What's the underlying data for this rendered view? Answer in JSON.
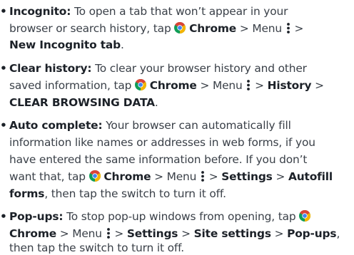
{
  "bullet_symbol": "•",
  "icons": {
    "chrome": "chrome-icon",
    "menu": "menu-dots-icon"
  },
  "colors": {
    "chrome_red": "#db4437",
    "chrome_yellow": "#f4b400",
    "chrome_green": "#0f9d58",
    "chrome_blue": "#4285f4",
    "text": "#3a4048",
    "bold_text": "#1c2128"
  },
  "items": [
    {
      "term": "Incognito:",
      "t1": " To open a tab that won’t appear in your",
      "t2": "browser or search history, tap ",
      "app": "Chrome",
      "sep": " > ",
      "menu_word": "Menu ",
      "gt": " >",
      "target": "New Incognito tab",
      "end": "."
    },
    {
      "term": "Clear history:",
      "t1": " To clear your browser history and other",
      "t2": "saved information, tap ",
      "app": "Chrome",
      "sep": " > ",
      "menu_word": "Menu ",
      "gt": " > ",
      "target1": "History",
      "gt2": " >",
      "target2": "CLEAR BROWSING DATA",
      "end": "."
    },
    {
      "term": "Auto complete:",
      "t1": " Your browser can automatically fill",
      "t2": "information like names or addresses in web forms, if you",
      "t3": "have entered the same information before. If you don’t",
      "t4": "want that, tap ",
      "app": "Chrome",
      "sep": " > ",
      "menu_word": "Menu ",
      "gt": " > ",
      "target1": "Settings",
      "gt2": " > ",
      "target2a": "Autofill",
      "target2b": "forms",
      "end": ", then tap the switch to turn it off."
    },
    {
      "term": "Pop-ups:",
      "t1": " To stop pop-up windows from opening, tap ",
      "app": "Chrome",
      "sep": " > ",
      "menu_word": "Menu ",
      "gt": " > ",
      "target1": "Settings",
      "gt2": " > ",
      "target2": "Site settings",
      "gt3": " > ",
      "target3": "Pop-ups",
      "end": ",",
      "t3": "then tap the switch to turn it off."
    }
  ]
}
